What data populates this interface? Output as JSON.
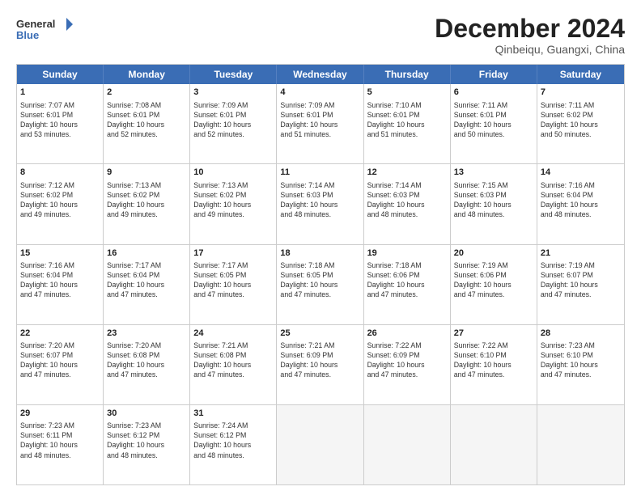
{
  "header": {
    "logo_line1": "General",
    "logo_line2": "Blue",
    "month": "December 2024",
    "location": "Qinbeiqu, Guangxi, China"
  },
  "days_of_week": [
    "Sunday",
    "Monday",
    "Tuesday",
    "Wednesday",
    "Thursday",
    "Friday",
    "Saturday"
  ],
  "weeks": [
    [
      {
        "day": "1",
        "lines": [
          "Sunrise: 7:07 AM",
          "Sunset: 6:01 PM",
          "Daylight: 10 hours",
          "and 53 minutes."
        ]
      },
      {
        "day": "2",
        "lines": [
          "Sunrise: 7:08 AM",
          "Sunset: 6:01 PM",
          "Daylight: 10 hours",
          "and 52 minutes."
        ]
      },
      {
        "day": "3",
        "lines": [
          "Sunrise: 7:09 AM",
          "Sunset: 6:01 PM",
          "Daylight: 10 hours",
          "and 52 minutes."
        ]
      },
      {
        "day": "4",
        "lines": [
          "Sunrise: 7:09 AM",
          "Sunset: 6:01 PM",
          "Daylight: 10 hours",
          "and 51 minutes."
        ]
      },
      {
        "day": "5",
        "lines": [
          "Sunrise: 7:10 AM",
          "Sunset: 6:01 PM",
          "Daylight: 10 hours",
          "and 51 minutes."
        ]
      },
      {
        "day": "6",
        "lines": [
          "Sunrise: 7:11 AM",
          "Sunset: 6:01 PM",
          "Daylight: 10 hours",
          "and 50 minutes."
        ]
      },
      {
        "day": "7",
        "lines": [
          "Sunrise: 7:11 AM",
          "Sunset: 6:02 PM",
          "Daylight: 10 hours",
          "and 50 minutes."
        ]
      }
    ],
    [
      {
        "day": "8",
        "lines": [
          "Sunrise: 7:12 AM",
          "Sunset: 6:02 PM",
          "Daylight: 10 hours",
          "and 49 minutes."
        ]
      },
      {
        "day": "9",
        "lines": [
          "Sunrise: 7:13 AM",
          "Sunset: 6:02 PM",
          "Daylight: 10 hours",
          "and 49 minutes."
        ]
      },
      {
        "day": "10",
        "lines": [
          "Sunrise: 7:13 AM",
          "Sunset: 6:02 PM",
          "Daylight: 10 hours",
          "and 49 minutes."
        ]
      },
      {
        "day": "11",
        "lines": [
          "Sunrise: 7:14 AM",
          "Sunset: 6:03 PM",
          "Daylight: 10 hours",
          "and 48 minutes."
        ]
      },
      {
        "day": "12",
        "lines": [
          "Sunrise: 7:14 AM",
          "Sunset: 6:03 PM",
          "Daylight: 10 hours",
          "and 48 minutes."
        ]
      },
      {
        "day": "13",
        "lines": [
          "Sunrise: 7:15 AM",
          "Sunset: 6:03 PM",
          "Daylight: 10 hours",
          "and 48 minutes."
        ]
      },
      {
        "day": "14",
        "lines": [
          "Sunrise: 7:16 AM",
          "Sunset: 6:04 PM",
          "Daylight: 10 hours",
          "and 48 minutes."
        ]
      }
    ],
    [
      {
        "day": "15",
        "lines": [
          "Sunrise: 7:16 AM",
          "Sunset: 6:04 PM",
          "Daylight: 10 hours",
          "and 47 minutes."
        ]
      },
      {
        "day": "16",
        "lines": [
          "Sunrise: 7:17 AM",
          "Sunset: 6:04 PM",
          "Daylight: 10 hours",
          "and 47 minutes."
        ]
      },
      {
        "day": "17",
        "lines": [
          "Sunrise: 7:17 AM",
          "Sunset: 6:05 PM",
          "Daylight: 10 hours",
          "and 47 minutes."
        ]
      },
      {
        "day": "18",
        "lines": [
          "Sunrise: 7:18 AM",
          "Sunset: 6:05 PM",
          "Daylight: 10 hours",
          "and 47 minutes."
        ]
      },
      {
        "day": "19",
        "lines": [
          "Sunrise: 7:18 AM",
          "Sunset: 6:06 PM",
          "Daylight: 10 hours",
          "and 47 minutes."
        ]
      },
      {
        "day": "20",
        "lines": [
          "Sunrise: 7:19 AM",
          "Sunset: 6:06 PM",
          "Daylight: 10 hours",
          "and 47 minutes."
        ]
      },
      {
        "day": "21",
        "lines": [
          "Sunrise: 7:19 AM",
          "Sunset: 6:07 PM",
          "Daylight: 10 hours",
          "and 47 minutes."
        ]
      }
    ],
    [
      {
        "day": "22",
        "lines": [
          "Sunrise: 7:20 AM",
          "Sunset: 6:07 PM",
          "Daylight: 10 hours",
          "and 47 minutes."
        ]
      },
      {
        "day": "23",
        "lines": [
          "Sunrise: 7:20 AM",
          "Sunset: 6:08 PM",
          "Daylight: 10 hours",
          "and 47 minutes."
        ]
      },
      {
        "day": "24",
        "lines": [
          "Sunrise: 7:21 AM",
          "Sunset: 6:08 PM",
          "Daylight: 10 hours",
          "and 47 minutes."
        ]
      },
      {
        "day": "25",
        "lines": [
          "Sunrise: 7:21 AM",
          "Sunset: 6:09 PM",
          "Daylight: 10 hours",
          "and 47 minutes."
        ]
      },
      {
        "day": "26",
        "lines": [
          "Sunrise: 7:22 AM",
          "Sunset: 6:09 PM",
          "Daylight: 10 hours",
          "and 47 minutes."
        ]
      },
      {
        "day": "27",
        "lines": [
          "Sunrise: 7:22 AM",
          "Sunset: 6:10 PM",
          "Daylight: 10 hours",
          "and 47 minutes."
        ]
      },
      {
        "day": "28",
        "lines": [
          "Sunrise: 7:23 AM",
          "Sunset: 6:10 PM",
          "Daylight: 10 hours",
          "and 47 minutes."
        ]
      }
    ],
    [
      {
        "day": "29",
        "lines": [
          "Sunrise: 7:23 AM",
          "Sunset: 6:11 PM",
          "Daylight: 10 hours",
          "and 48 minutes."
        ]
      },
      {
        "day": "30",
        "lines": [
          "Sunrise: 7:23 AM",
          "Sunset: 6:12 PM",
          "Daylight: 10 hours",
          "and 48 minutes."
        ]
      },
      {
        "day": "31",
        "lines": [
          "Sunrise: 7:24 AM",
          "Sunset: 6:12 PM",
          "Daylight: 10 hours",
          "and 48 minutes."
        ]
      },
      {
        "day": "",
        "lines": []
      },
      {
        "day": "",
        "lines": []
      },
      {
        "day": "",
        "lines": []
      },
      {
        "day": "",
        "lines": []
      }
    ]
  ]
}
